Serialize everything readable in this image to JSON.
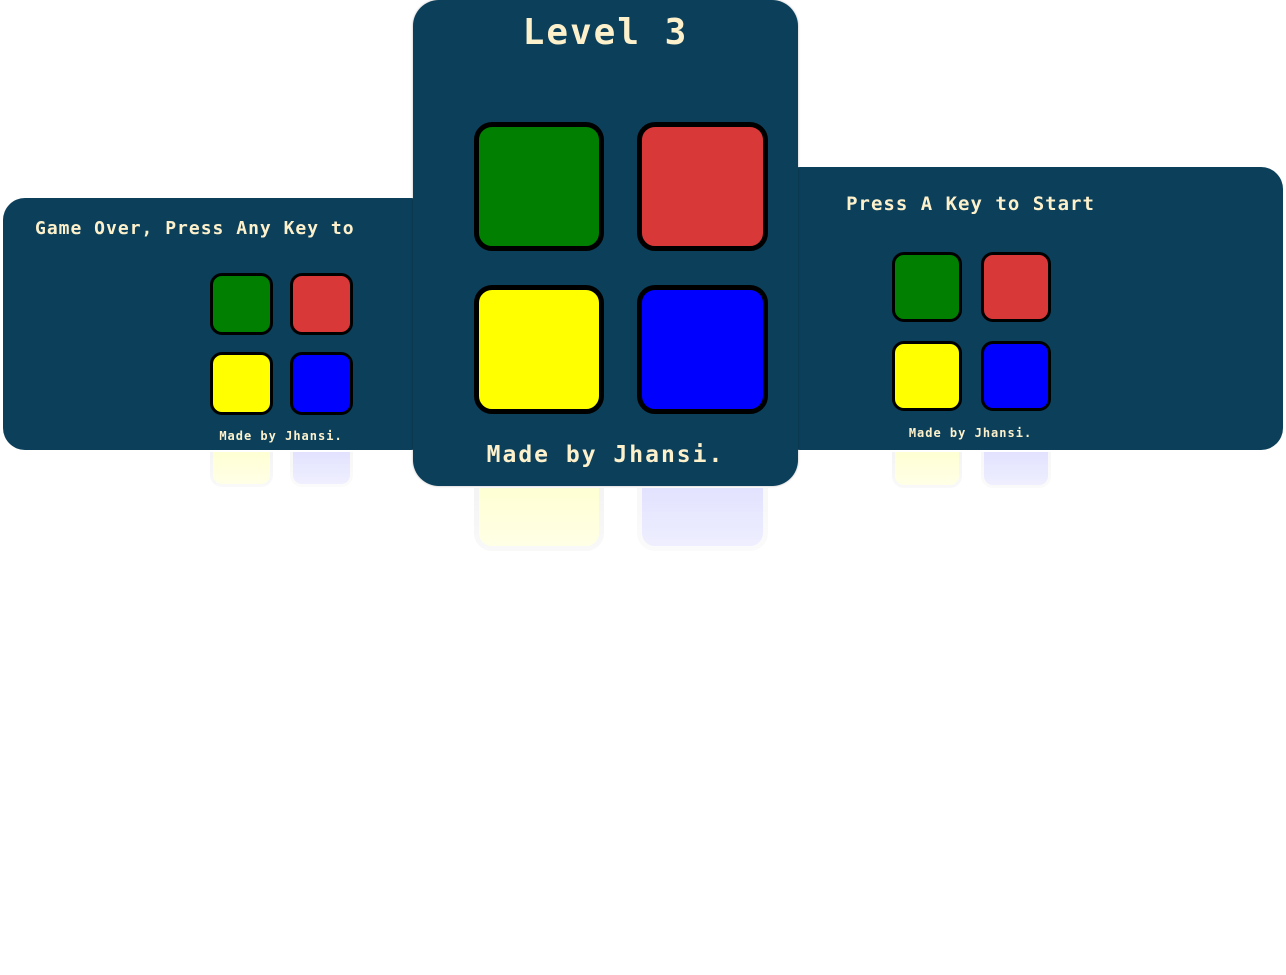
{
  "cards": {
    "left": {
      "title": "Game Over, Press Any Key to",
      "footer": "Made by Jhansi."
    },
    "center": {
      "title": "Level 3",
      "footer": "Made by Jhansi."
    },
    "right": {
      "title": "Press A Key to Start",
      "footer": "Made by Jhansi."
    }
  },
  "pads": [
    "green",
    "red",
    "yellow",
    "blue"
  ],
  "colors": {
    "background": "#0b3f5a",
    "text": "#fdf1cc",
    "green": "#007f00",
    "red": "#d83838",
    "yellow": "#ffff00",
    "blue": "#0000ff"
  }
}
